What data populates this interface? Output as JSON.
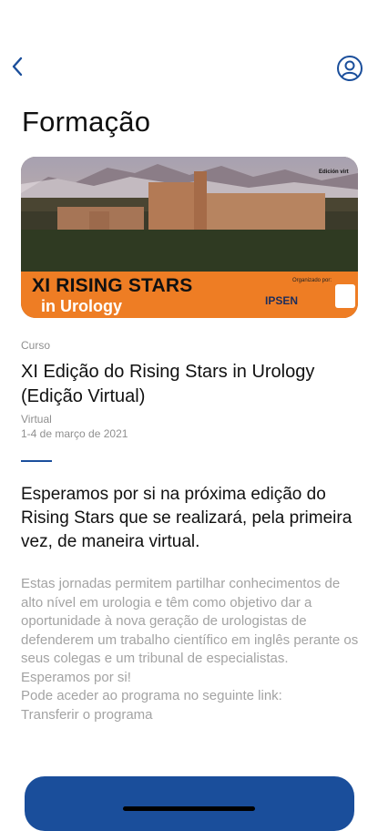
{
  "page": {
    "title": "Formação"
  },
  "banner": {
    "title_line1": "XI RISING STARS",
    "title_line2": "in Urology",
    "organized_label": "Organizado por:",
    "virtual_tag": "Edición virt",
    "sponsor": "IPSEN"
  },
  "event": {
    "type_label": "Curso",
    "title": "XI Edição do Rising Stars in Urology (Edição Virtual)",
    "mode": "Virtual",
    "date": "1-4 de março de 2021"
  },
  "content": {
    "lead": "Esperamos por si na próxima edição do Rising Stars que se realizará, pela primeira vez, de maneira virtual.",
    "paragraph1": "Estas jornadas permitem partilhar conhecimentos de alto nível em urologia e têm como objetivo dar a oportunidade à nova geração de urologistas de defenderem um trabalho científico em inglês perante os seus colegas e um tribunal de especialistas.",
    "paragraph2": "Esperamos por si!",
    "paragraph3": "Pode aceder ao programa no seguinte link:",
    "link_text": "Transferir o programa"
  },
  "icons": {
    "back": "chevron-left-icon",
    "profile": "user-circle-icon"
  },
  "colors": {
    "accent": "#1a4e9b",
    "banner_orange": "#ee7d24"
  }
}
